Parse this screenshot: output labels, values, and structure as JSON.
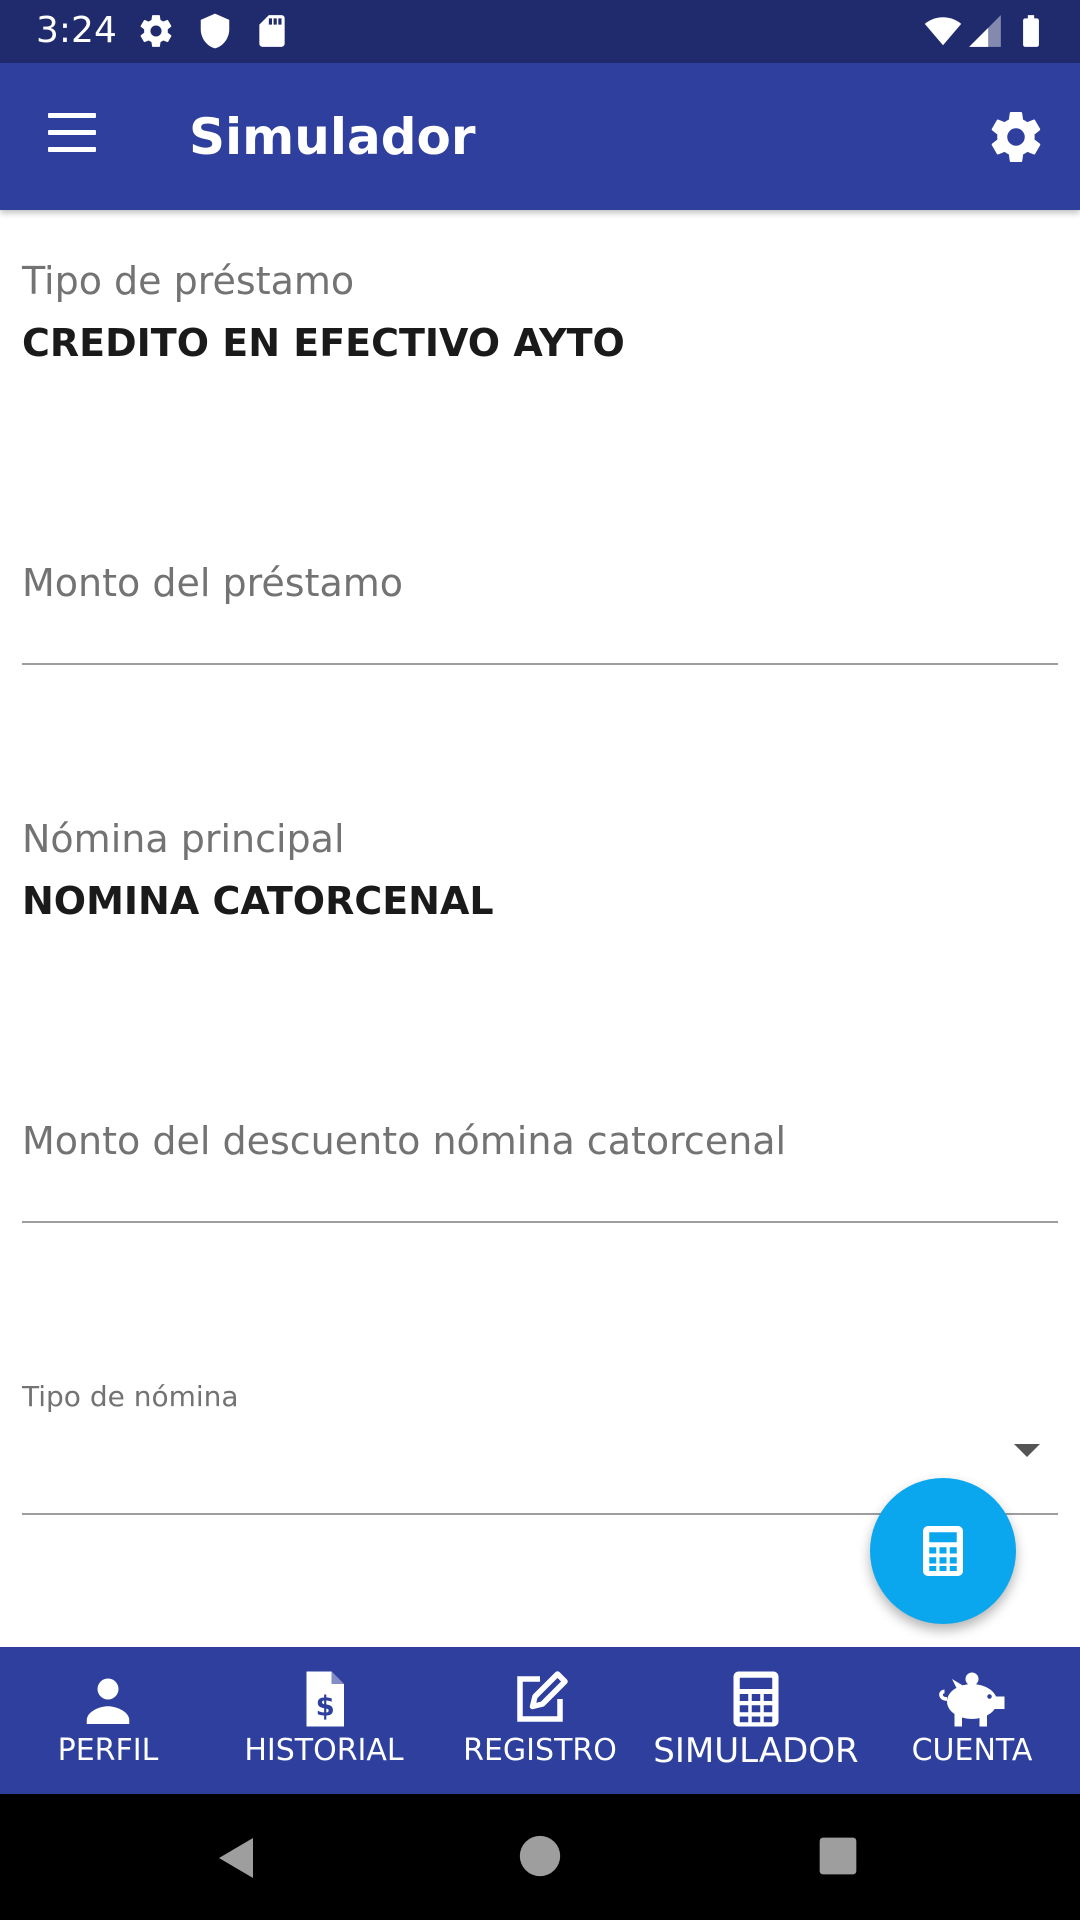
{
  "status_bar": {
    "time": "3:24",
    "left_icons": [
      "gear-icon",
      "shield-icon",
      "sd-card-icon"
    ],
    "right_icons": [
      "wifi-icon",
      "cell-signal-icon",
      "battery-icon"
    ]
  },
  "app_bar": {
    "title": "Simulador",
    "left_icon": "hamburger-menu-icon",
    "right_icon": "settings-icon",
    "background": "#2e3f9e"
  },
  "form": {
    "loan_type": {
      "label": "Tipo de préstamo",
      "value": "CREDITO EN EFECTIVO AYTO"
    },
    "loan_amount": {
      "placeholder": "Monto del préstamo",
      "value": ""
    },
    "main_payroll": {
      "label": "Nómina principal",
      "value": "NOMINA CATORCENAL"
    },
    "discount_amount": {
      "placeholder": "Monto del descuento nómina catorcenal",
      "value": ""
    },
    "payroll_type": {
      "label": "Tipo de nómina",
      "selected": ""
    }
  },
  "fab": {
    "icon": "calculator-icon",
    "color": "#0aa7ef"
  },
  "bottom_nav": {
    "items": [
      {
        "label": "PERFIL",
        "icon": "person-icon"
      },
      {
        "label": "HISTORIAL",
        "icon": "document-dollar-icon"
      },
      {
        "label": "REGISTRO",
        "icon": "edit-icon"
      },
      {
        "label": "SIMULADOR",
        "icon": "calculator-icon",
        "active": true
      },
      {
        "label": "CUENTA",
        "icon": "piggy-bank-icon"
      }
    ]
  },
  "system_nav": [
    "back-icon",
    "home-icon",
    "recents-icon"
  ]
}
